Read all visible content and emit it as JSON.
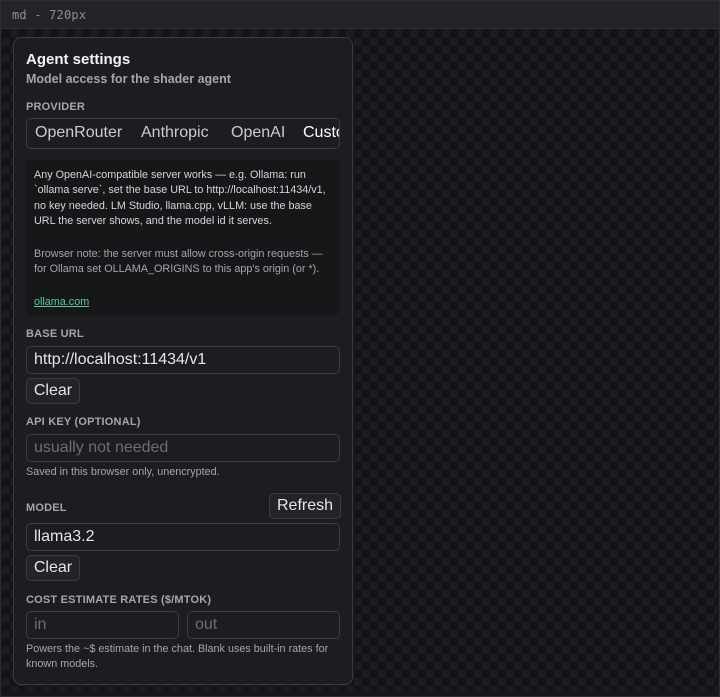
{
  "frame": {
    "label": "md - 720px"
  },
  "panel": {
    "title": "Agent settings",
    "subtitle": "Model access for the shader agent"
  },
  "provider": {
    "label": "PROVIDER",
    "tabs": [
      "OpenRouter",
      "Anthropic",
      "OpenAI",
      "Custom"
    ],
    "selected": "Custom"
  },
  "note": {
    "p1": "Any OpenAI-compatible server works — e.g. Ollama: run `ollama serve`, set the base URL to http://localhost:11434/v1, no key needed. LM Studio, llama.cpp, vLLM: use the base URL the server shows, and the model id it serves.",
    "p2": "Browser note: the server must allow cross-origin requests — for Ollama set OLLAMA_ORIGINS to this app's origin (or *).",
    "link": "ollama.com"
  },
  "base_url": {
    "label": "BASE URL",
    "value": "http://localhost:11434/v1",
    "clear_label": "Clear"
  },
  "api_key": {
    "label": "API KEY (OPTIONAL)",
    "placeholder": "usually not needed",
    "hint": "Saved in this browser only, unencrypted."
  },
  "model": {
    "label": "MODEL",
    "refresh_label": "Refresh",
    "value": "llama3.2",
    "clear_label": "Clear"
  },
  "cost": {
    "label": "COST ESTIMATE RATES ($/MTOK)",
    "in_placeholder": "in",
    "out_placeholder": "out",
    "hint": "Powers the ~$ estimate in the chat. Blank uses built-in rates for known models."
  },
  "colors": {
    "accent_link": "#5fc99a",
    "panel_bg": "#1c1d20",
    "border": "#3a3c41"
  }
}
